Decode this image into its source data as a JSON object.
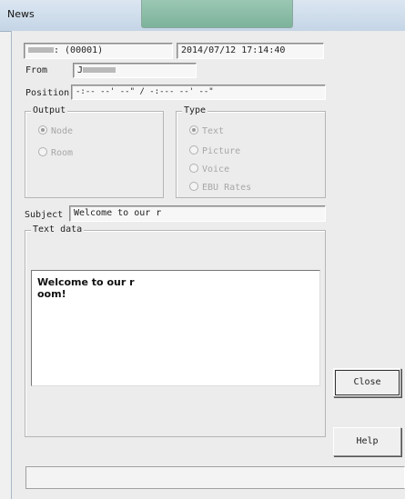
{
  "window": {
    "title": "News"
  },
  "header": {
    "id_label": ": (00001)",
    "timestamp": "2014/07/12 17:14:40",
    "from_label": "From",
    "from_value": "J",
    "position_label": "Position",
    "position_value": "-:-- --' --\" / -:--- --' --\""
  },
  "output": {
    "title": "Output",
    "options": [
      {
        "label": "Node",
        "selected": true
      },
      {
        "label": "Room",
        "selected": false
      }
    ]
  },
  "type": {
    "title": "Type",
    "options": [
      {
        "label": "Text",
        "selected": true
      },
      {
        "label": "Picture",
        "selected": false
      },
      {
        "label": "Voice",
        "selected": false
      },
      {
        "label": "EBU Rates",
        "selected": false
      }
    ]
  },
  "subject": {
    "label": "Subject",
    "value": "Welcome to our r"
  },
  "textdata": {
    "title": "Text data",
    "body": "Welcome to our r\noom!"
  },
  "buttons": {
    "close": "Close",
    "help": "Help"
  },
  "status": {
    "text": ""
  }
}
